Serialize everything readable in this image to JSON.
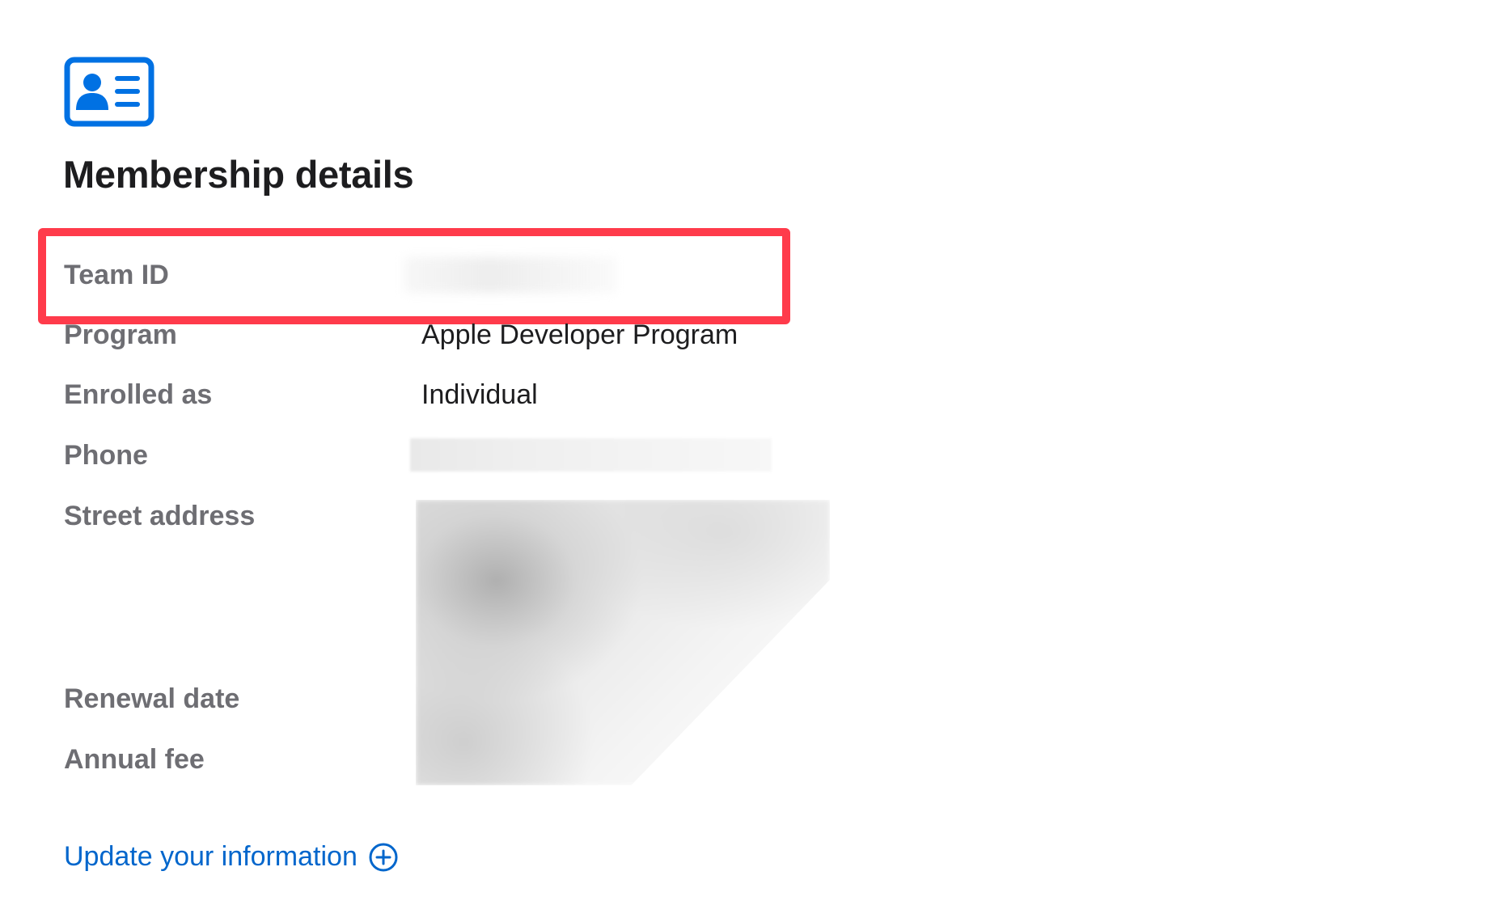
{
  "page": {
    "title": "Membership details",
    "icon": "contact-card-icon",
    "accent_color": "#0071e3",
    "highlight_color": "#ff3b4b"
  },
  "details": {
    "team_id": {
      "label": "Team ID",
      "value": ""
    },
    "program": {
      "label": "Program",
      "value": "Apple Developer Program"
    },
    "enrolled_as": {
      "label": "Enrolled as",
      "value": "Individual"
    },
    "phone": {
      "label": "Phone",
      "value": ""
    },
    "street_address": {
      "label": "Street address",
      "value": ""
    },
    "renewal_date": {
      "label": "Renewal date",
      "value": ""
    },
    "annual_fee": {
      "label": "Annual fee",
      "value": ""
    }
  },
  "actions": {
    "update_label": "Update your information",
    "update_icon": "plus-circle-icon"
  }
}
